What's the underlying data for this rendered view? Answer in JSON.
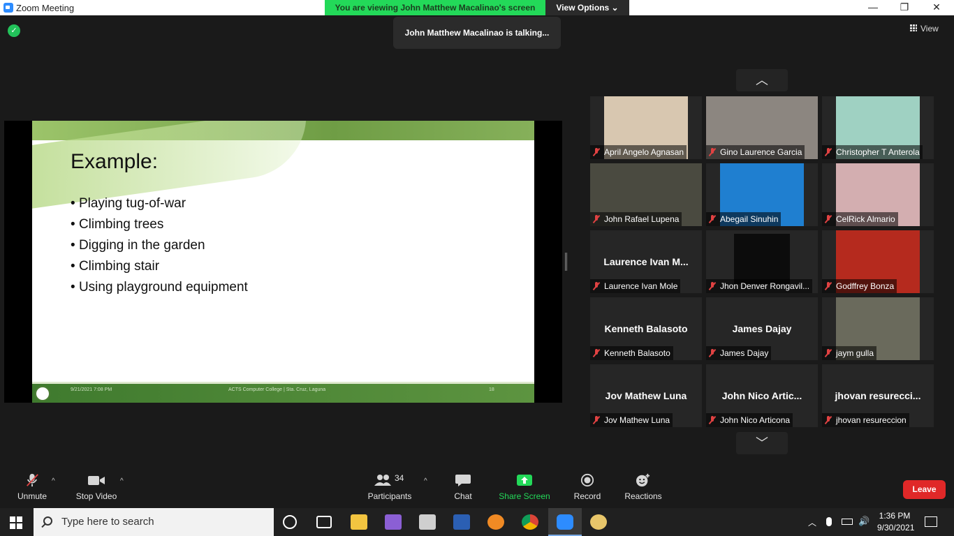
{
  "window": {
    "title": "Zoom Meeting",
    "minimize": "—",
    "maximize": "❐",
    "close": "✕"
  },
  "banner": {
    "viewing": "You are viewing John Matthew Macalinao's screen",
    "view_options": "View Options ⌄"
  },
  "talking": "John Matthew Macalinao is talking...",
  "view_toggle": "View",
  "slide": {
    "heading": "Example:",
    "bullets": [
      "Playing tug-of-war",
      "Climbing trees",
      "Digging in the garden",
      "Climbing stair",
      "Using playground equipment"
    ],
    "footer_date": "9/21/2021 7:08 PM",
    "footer_center": "ACTS Computer College | Sta. Cruz, Laguna",
    "footer_page": "18"
  },
  "gallery": {
    "up": "︿",
    "down": "﹀",
    "tiles": [
      {
        "name": "April Angelo Agnasan",
        "video_color": "#d8c7b0"
      },
      {
        "name": "Gino Laurence Garcia",
        "video_color": "#8c8680"
      },
      {
        "name": "Christopher T Anterola",
        "video_color": "#9fd1c2"
      },
      {
        "name": "John Rafael Lupena",
        "video_color": "#4a4a40"
      },
      {
        "name": "Abegail Sinuhin",
        "video_color": "#1f7fd0"
      },
      {
        "name": "CelRick Almario",
        "video_color": "#d3aeb0"
      },
      {
        "name": "Laurence Ivan Mole",
        "big_name": "Laurence Ivan M..."
      },
      {
        "name": "Jhon Denver Rongavil...",
        "video_color": "#0c0c0c"
      },
      {
        "name": "Godffrey Bonza",
        "video_color": "#b52a1e"
      },
      {
        "name": "Kenneth Balasoto",
        "big_name": "Kenneth Balasoto"
      },
      {
        "name": "James Dajay",
        "big_name": "James Dajay"
      },
      {
        "name": "jaym gulla",
        "video_color": "#6a6a5c"
      },
      {
        "name": "Jov Mathew  Luna",
        "big_name": "Jov Mathew  Luna"
      },
      {
        "name": "John Nico Articona",
        "big_name": "John  Nico  Artic..."
      },
      {
        "name": "jhovan resureccion",
        "big_name": "jhovan  resurecci..."
      }
    ]
  },
  "toolbar": {
    "unmute": "Unmute",
    "stop_video": "Stop Video",
    "participants": "Participants",
    "participants_count": "34",
    "chat": "Chat",
    "share_screen": "Share Screen",
    "record": "Record",
    "reactions": "Reactions",
    "leave": "Leave",
    "caret": "^"
  },
  "taskbar": {
    "search_placeholder": "Type here to search",
    "time": "1:36 PM",
    "date": "9/30/2021",
    "tray_caret": "︿"
  },
  "colors": {
    "banner_green": "#23d959",
    "share_green": "#23d959",
    "leave_red": "#e02828",
    "mute_red": "#e14242"
  }
}
